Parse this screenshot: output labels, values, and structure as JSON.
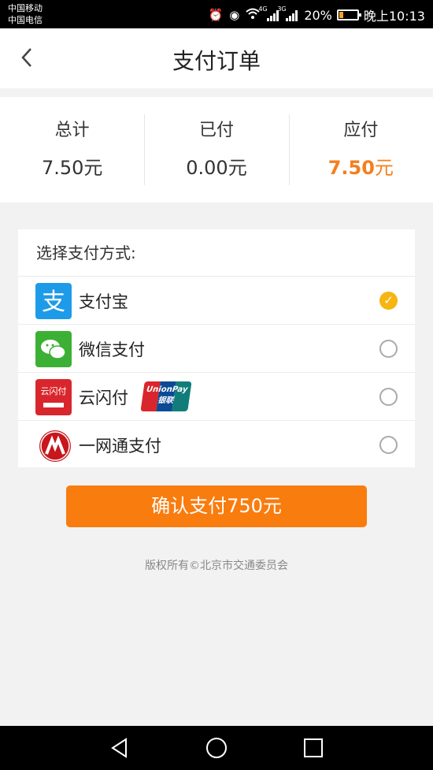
{
  "statusbar": {
    "carrier1": "中国移动",
    "carrier2": "中国电信",
    "sig1_label": "4G",
    "sig2_label": "3G",
    "battery": "20%",
    "time": "晚上10:13"
  },
  "header": {
    "back_glyph": "‹",
    "title": "支付订单"
  },
  "summary": {
    "total_label": "总计",
    "total_value": "7.50元",
    "paid_label": "已付",
    "paid_value": "0.00元",
    "due_label": "应付",
    "due_number": "7.50",
    "due_unit": "元"
  },
  "payment": {
    "heading": "选择支付方式:",
    "methods": [
      {
        "label": "支付宝",
        "icon": "alipay-icon",
        "selected": true
      },
      {
        "label": "微信支付",
        "icon": "wechat-pay-icon",
        "selected": false
      },
      {
        "label": "云闪付",
        "icon": "yunshanfu-icon",
        "badge": "UnionPay 银联",
        "selected": false
      },
      {
        "label": "一网通支付",
        "icon": "cmb-icon",
        "selected": false
      }
    ]
  },
  "confirm_label": "确认支付750元",
  "copyright": "版权所有©北京市交通委员会",
  "colors": {
    "accent": "#f97c0e",
    "due": "#f47f1e",
    "check": "#f7b511"
  }
}
